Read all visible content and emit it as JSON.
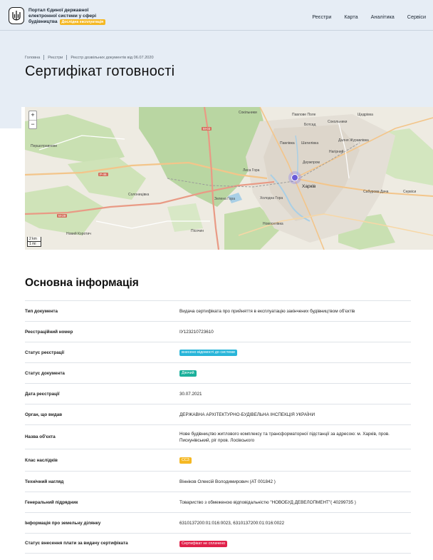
{
  "header": {
    "brand_line1": "Портал Єдиної державної",
    "brand_line2": "електронної системи у сфері",
    "brand_line3": "будівництва",
    "test_badge": "Дослідна експлуатація",
    "nav": [
      "Реєстри",
      "Карта",
      "Аналітика",
      "Сервіси"
    ]
  },
  "breadcrumb": [
    "Головна",
    "Реєстри",
    "Реєстр дозвільних документів від 06.07.2020"
  ],
  "page_title": "Сертифікат готовності",
  "map": {
    "zoom_in": "+",
    "zoom_out": "−",
    "scale_km": "2 km",
    "scale_mi": "1 mi",
    "labels": {
      "pershotravneve": "Першотравневе",
      "sokilnyky": "Сокільники",
      "pavlove_pole": "Павлове Поле",
      "shchetynivka": "Щедрівка",
      "botsad": "Ботсад",
      "sokilnyky2": "Сокольники",
      "shatylivka": "Шатилівка",
      "pavlivka": "Павлівка",
      "nahirnyi": "Нагірний",
      "dalnia": "Далня Журавлівка",
      "derzhprom": "Держпром",
      "lysa_gora": "Лиса Гора",
      "kharkiv": "Харків",
      "solonytsivka": "Солоницівка",
      "pisochyn": "Пісочин",
      "novoselivka": "Новоселівка",
      "novyi_korotych": "Новий Коротич",
      "saburova": "Сабурова Дача",
      "zelena": "Зелена Гора",
      "kholodna": "Холодна Гора",
      "m03": "М-03",
      "r46": "Р-46",
      "m29": "М-29",
      "servisy": "Сервіси"
    }
  },
  "section_title": "Основна інформація",
  "colors": {
    "status_registration": "#28b5d9",
    "status_document": "#1bb09b",
    "class_cc": "#f5b823",
    "payment_status": "#e0214a"
  },
  "info": [
    {
      "label": "Тип документа",
      "value": "Видача сертифіката про прийняття в експлуатацію закінчених будівництвом об'єктів"
    },
    {
      "label": "Реєстраційний номер",
      "value": "ІУ123210723610"
    },
    {
      "label": "Статус реєстрації",
      "value": "внесено відомості до системи"
    },
    {
      "label": "Статус документа",
      "value": "Діючий"
    },
    {
      "label": "Дата реєстрації",
      "value": "30.07.2021"
    },
    {
      "label": "Орган, що видав",
      "value": "ДЕРЖАВНА АРХІТЕКТУРНО-БУДІВЕЛЬНА ІНСПЕКЦІЯ УКРАЇНИ"
    },
    {
      "label": "Назва об'єкта",
      "value": "Нове будівництво житлового комплексу та трансформаторної підстанції за адресою: м. Харків, пров. Пискунівський, ріг пров. Лосівського"
    },
    {
      "label": "Клас наслідків",
      "value": "СС3"
    },
    {
      "label": "Технічний нагляд",
      "value": "Вінніков Олексій Володимирович (АТ 001842 )"
    },
    {
      "label": "Генеральний підрядник",
      "value": "Товариство з обмеженою відповідальністю \"НОВОБУД ДЕВЕЛОПМЕНТ\"( 40299735 )"
    },
    {
      "label": "Інформація про земельну ділянку",
      "value": "6310137200:01:016:0023, 6310137200:01:016:0022"
    },
    {
      "label": "Статус внесення плати за видачу сертифіката",
      "value": "Сертифікат не сплачено"
    }
  ]
}
